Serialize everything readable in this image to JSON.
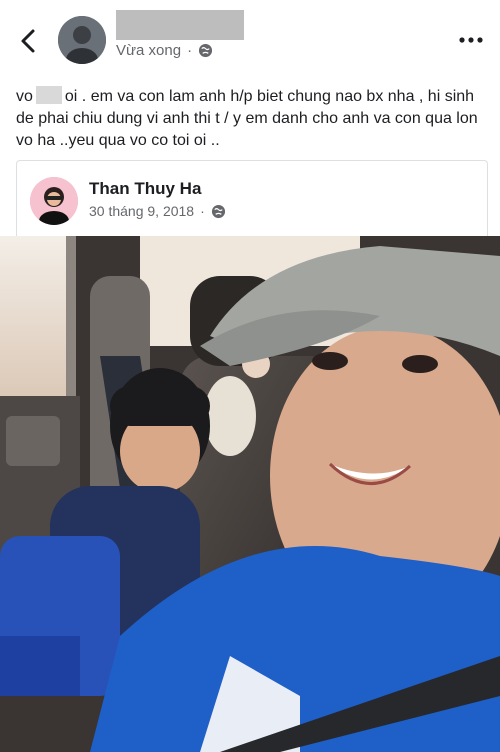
{
  "post": {
    "timestamp": "Vừa xong",
    "privacy_icon": "globe-icon",
    "text_before": "vo",
    "text_after": "oi . em va con lam anh h/p biet chung nao bx nha , hi sinh de phai chiu dung vi anh thi t / y em danh cho anh va con qua lon vo ha ..yeu qua vo co toi oi .."
  },
  "shared": {
    "name": "Than Thuy Ha",
    "date": "30 tháng 9, 2018"
  },
  "colors": {
    "secondary_text": "#65676b",
    "card_border": "#dddfe2",
    "cap": "#9a9d98",
    "shirt": "#1f5fc8"
  }
}
